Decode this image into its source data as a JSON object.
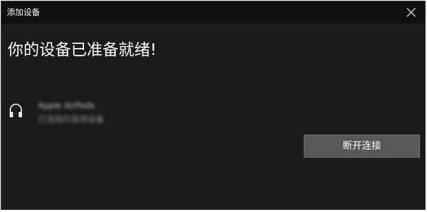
{
  "window": {
    "title": "添加设备"
  },
  "main": {
    "heading": "你的设备已准备就绪!",
    "device": {
      "icon": "headphones-icon",
      "name": "Apple AirPods",
      "status": "已连接的音频设备"
    },
    "disconnect_label": "断开连接"
  },
  "colors": {
    "background": "#1b1b1b",
    "titlebar": "#0f0f0f",
    "button": "#585858",
    "text": "#ffffff"
  }
}
